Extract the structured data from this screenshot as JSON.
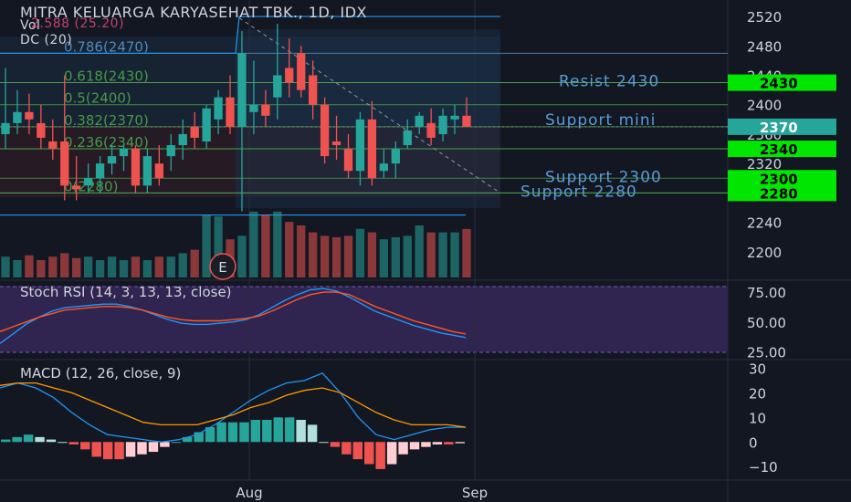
{
  "header": {
    "title": "MITRA KELUARGA KARYASEHAT TBK., 1D, IDX",
    "vol_label": "Vol",
    "vol_overlay": "2.588 (25.20)",
    "dc_label": "DC (20)"
  },
  "colors": {
    "background": "#131722",
    "up": "#26a69a",
    "down": "#ef5350",
    "fib_blue": "#5b9bd5",
    "fib_green": "#4caf50",
    "tag_green": "#00e600",
    "price_tag": "#26a69a",
    "donchian": "#2196f3",
    "stoch_k": "#2196f3",
    "stoch_d": "#ff5722",
    "stoch_band": "#3b2a60",
    "macd_line": "#2196f3",
    "signal_line": "#ff9800"
  },
  "chart_data": [
    {
      "type": "candlestick",
      "title": "MITRA KELUARGA KARYASEHAT TBK., 1D, IDX",
      "ylim": [
        2170,
        2530
      ],
      "y_ticks": [
        2200,
        2240,
        2280,
        2320,
        2360,
        2400,
        2440,
        2480,
        2520
      ],
      "x_ticks": [
        "Aug",
        "Sep"
      ],
      "candles": [
        {
          "o": 2360,
          "h": 2450,
          "l": 2340,
          "c": 2375
        },
        {
          "o": 2375,
          "h": 2420,
          "l": 2360,
          "c": 2390
        },
        {
          "o": 2390,
          "h": 2415,
          "l": 2360,
          "c": 2380
        },
        {
          "o": 2375,
          "h": 2400,
          "l": 2340,
          "c": 2355
        },
        {
          "o": 2350,
          "h": 2380,
          "l": 2325,
          "c": 2340
        },
        {
          "o": 2350,
          "h": 2440,
          "l": 2270,
          "c": 2290
        },
        {
          "o": 2290,
          "h": 2330,
          "l": 2270,
          "c": 2285
        },
        {
          "o": 2290,
          "h": 2320,
          "l": 2280,
          "c": 2300
        },
        {
          "o": 2300,
          "h": 2330,
          "l": 2280,
          "c": 2320
        },
        {
          "o": 2320,
          "h": 2345,
          "l": 2305,
          "c": 2330
        },
        {
          "o": 2330,
          "h": 2345,
          "l": 2310,
          "c": 2340
        },
        {
          "o": 2340,
          "h": 2345,
          "l": 2280,
          "c": 2290
        },
        {
          "o": 2290,
          "h": 2340,
          "l": 2280,
          "c": 2330
        },
        {
          "o": 2320,
          "h": 2345,
          "l": 2290,
          "c": 2300
        },
        {
          "o": 2330,
          "h": 2360,
          "l": 2310,
          "c": 2345
        },
        {
          "o": 2345,
          "h": 2380,
          "l": 2325,
          "c": 2360
        },
        {
          "o": 2370,
          "h": 2390,
          "l": 2340,
          "c": 2355
        },
        {
          "o": 2350,
          "h": 2400,
          "l": 2340,
          "c": 2395
        },
        {
          "o": 2380,
          "h": 2420,
          "l": 2360,
          "c": 2410
        },
        {
          "o": 2410,
          "h": 2440,
          "l": 2360,
          "c": 2370
        },
        {
          "o": 2370,
          "h": 2500,
          "l": 2255,
          "c": 2470
        },
        {
          "o": 2390,
          "h": 2460,
          "l": 2360,
          "c": 2400
        },
        {
          "o": 2400,
          "h": 2420,
          "l": 2370,
          "c": 2385
        },
        {
          "o": 2410,
          "h": 2510,
          "l": 2380,
          "c": 2440
        },
        {
          "o": 2450,
          "h": 2490,
          "l": 2410,
          "c": 2430
        },
        {
          "o": 2470,
          "h": 2480,
          "l": 2410,
          "c": 2420
        },
        {
          "o": 2440,
          "h": 2460,
          "l": 2380,
          "c": 2400
        },
        {
          "o": 2400,
          "h": 2410,
          "l": 2320,
          "c": 2330
        },
        {
          "o": 2350,
          "h": 2385,
          "l": 2325,
          "c": 2345
        },
        {
          "o": 2340,
          "h": 2360,
          "l": 2300,
          "c": 2310
        },
        {
          "o": 2310,
          "h": 2390,
          "l": 2290,
          "c": 2380
        },
        {
          "o": 2380,
          "h": 2405,
          "l": 2290,
          "c": 2300
        },
        {
          "o": 2310,
          "h": 2340,
          "l": 2300,
          "c": 2320
        },
        {
          "o": 2320,
          "h": 2350,
          "l": 2300,
          "c": 2340
        },
        {
          "o": 2345,
          "h": 2380,
          "l": 2340,
          "c": 2365
        },
        {
          "o": 2370,
          "h": 2390,
          "l": 2360,
          "c": 2385
        },
        {
          "o": 2375,
          "h": 2395,
          "l": 2345,
          "c": 2355
        },
        {
          "o": 2360,
          "h": 2395,
          "l": 2350,
          "c": 2385
        },
        {
          "o": 2380,
          "h": 2400,
          "l": 2360,
          "c": 2385
        },
        {
          "o": 2385,
          "h": 2410,
          "l": 2370,
          "c": 2370
        }
      ],
      "volume_pct": [
        0.3,
        0.25,
        0.32,
        0.25,
        0.3,
        0.35,
        0.28,
        0.3,
        0.25,
        0.3,
        0.25,
        0.3,
        0.25,
        0.3,
        0.3,
        0.35,
        0.4,
        0.9,
        0.88,
        0.55,
        0.6,
        0.95,
        0.9,
        0.95,
        0.8,
        0.75,
        0.65,
        0.6,
        0.58,
        0.6,
        0.7,
        0.65,
        0.55,
        0.58,
        0.6,
        0.75,
        0.65,
        0.65,
        0.65,
        0.7
      ],
      "fibonacci": [
        {
          "label": "0.786(2470)",
          "value": 2470
        },
        {
          "label": "0.618(2430)",
          "value": 2430
        },
        {
          "label": "0.5(2400)",
          "value": 2400
        },
        {
          "label": "0.382(2370)",
          "value": 2370
        },
        {
          "label": "0.236(2340)",
          "value": 2340
        },
        {
          "label": "0(2280)",
          "value": 2280
        }
      ],
      "levels": [
        {
          "label": "Resist 2430",
          "value": 2430
        },
        {
          "label": "Support mini",
          "value": 2355
        },
        {
          "label": "Support 2300",
          "value": 2300
        },
        {
          "label": "Support 2280",
          "value": 2280
        }
      ],
      "price_tags": [
        {
          "text": "2430",
          "value": 2430,
          "style": "green"
        },
        {
          "text": "2370",
          "value": 2370,
          "style": "current"
        },
        {
          "text": "2340",
          "value": 2340,
          "style": "green"
        },
        {
          "text": "2300",
          "value": 2300,
          "style": "green"
        },
        {
          "text": "2280",
          "value": 2280,
          "style": "green"
        }
      ],
      "donchian": {
        "upper": 2520,
        "lower": 2250
      },
      "earnings_marker": "E"
    },
    {
      "type": "line",
      "title": "Stoch RSI (14, 3, 13, 13, close)",
      "ylim": [
        20,
        82
      ],
      "y_ticks": [
        "75.00",
        "50.00",
        "25.00"
      ],
      "y_tick_values": [
        75,
        50,
        25
      ],
      "band": [
        25,
        80
      ],
      "series": [
        {
          "values": [
            32,
            40,
            48,
            54,
            59,
            62,
            63,
            64,
            65,
            65,
            63,
            60,
            56,
            52,
            49,
            48,
            48,
            49,
            50,
            52,
            56,
            62,
            68,
            73,
            77,
            78,
            76,
            71,
            65,
            59,
            55,
            51,
            47,
            44,
            41,
            39,
            37
          ]
        },
        {
          "values": [
            42,
            46,
            50,
            54,
            57,
            60,
            61,
            62,
            63,
            63,
            62,
            60,
            57,
            54,
            52,
            51,
            51,
            51,
            52,
            53,
            55,
            59,
            64,
            69,
            73,
            75,
            75,
            73,
            68,
            63,
            59,
            55,
            51,
            48,
            45,
            42,
            40
          ]
        }
      ]
    },
    {
      "type": "bar+line",
      "title": "MACD (12, 26, close, 9)",
      "ylim": [
        -14,
        32
      ],
      "y_ticks": [
        30,
        20,
        10,
        0,
        -10
      ],
      "histogram": [
        1,
        2,
        3,
        2,
        1,
        0,
        -1,
        -3,
        -6,
        -7,
        -7,
        -6,
        -5,
        -4,
        -2,
        0,
        2,
        4,
        6,
        8,
        8,
        8,
        9,
        9,
        10,
        10,
        9,
        7,
        0,
        -2,
        -5,
        -7,
        -9,
        -11,
        -9,
        -5,
        -3,
        -2,
        -1,
        -1,
        -0.5
      ],
      "series": [
        {
          "values": [
            22,
            24,
            22,
            18,
            12,
            7,
            3,
            2,
            1,
            0,
            1,
            3,
            7,
            12,
            17,
            21,
            24,
            25,
            28,
            20,
            10,
            3,
            1,
            3,
            5,
            6,
            6
          ]
        },
        {
          "values": [
            23,
            24,
            24,
            22,
            20,
            17,
            14,
            11,
            8,
            7,
            7,
            7,
            9,
            11,
            14,
            16,
            19,
            21,
            22,
            20,
            16,
            12,
            9,
            7,
            7,
            7,
            6
          ]
        }
      ]
    }
  ]
}
